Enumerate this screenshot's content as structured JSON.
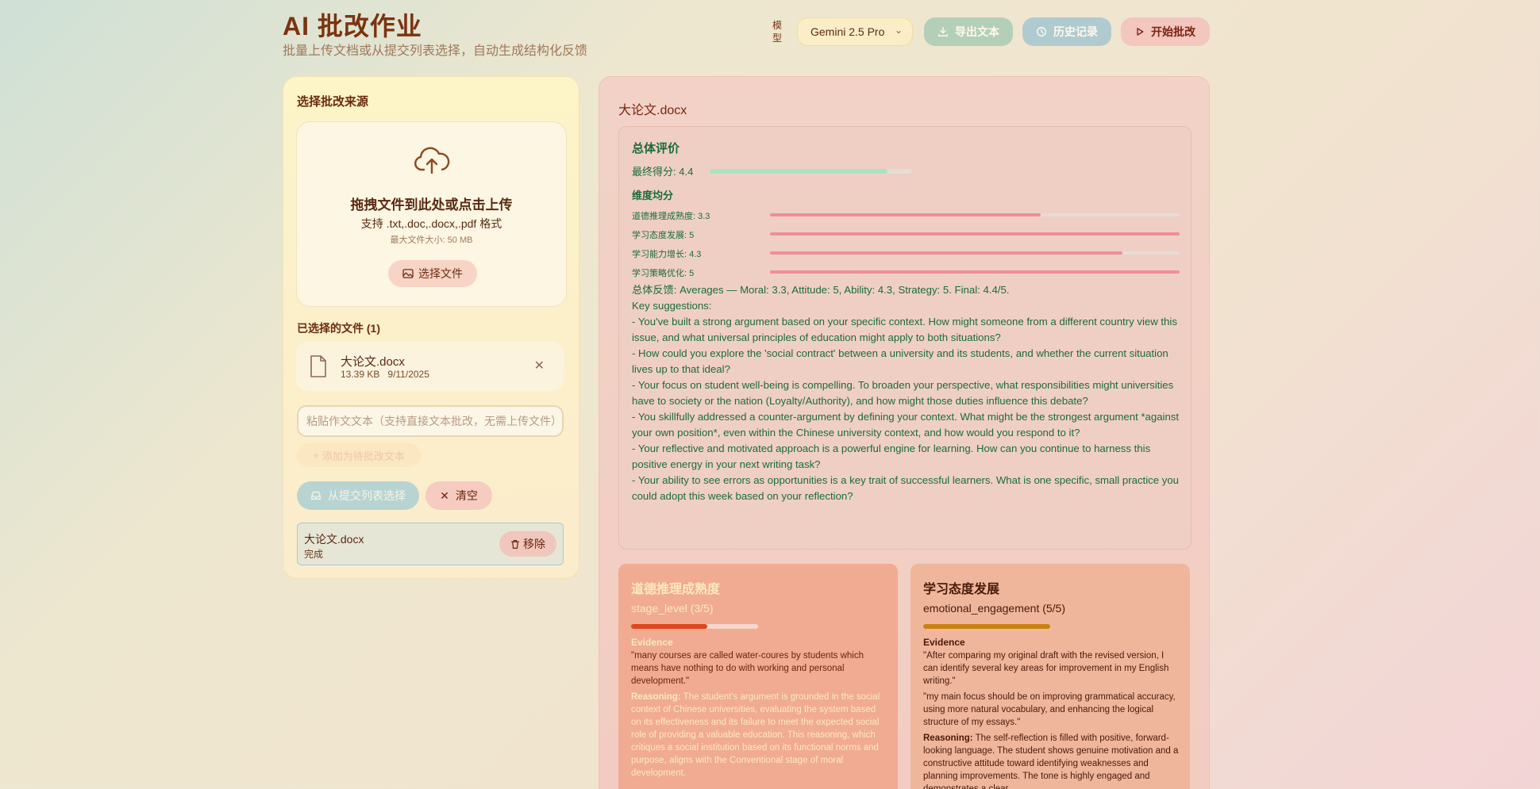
{
  "header": {
    "title": "AI 批改作业",
    "subtitle": "批量上传文档或从提交列表选择，自动生成结构化反馈",
    "model_label": "模型",
    "model_value": "Gemini 2.5 Pro",
    "export_label": "导出文本",
    "history_label": "历史记录",
    "start_label": "开始批改"
  },
  "left": {
    "title": "选择批改来源",
    "dropzone": {
      "title": "拖拽文件到此处或点击上传",
      "formats": "支持 .txt,.doc,.docx,.pdf 格式",
      "max_size": "最大文件大小: 50 MB",
      "choose_label": "选择文件"
    },
    "selected_title": "已选择的文件 (1)",
    "file": {
      "name": "大论文.docx",
      "size": "13.39 KB",
      "date": "9/11/2025"
    },
    "text_placeholder": "粘贴作文文本（支持直接文本批改，无需上传文件）",
    "add_label": "添加为待批改文本",
    "from_list_label": "从提交列表选择",
    "clear_label": "清空",
    "queue": {
      "name": "大论文.docx",
      "status": "完成",
      "remove_label": "移除"
    }
  },
  "right": {
    "title": "大论文.docx",
    "summary": {
      "title": "总体评价",
      "final_score_label": "最终得分: 4.4",
      "final_score": 4.4,
      "final_max": 5,
      "dimensions_title": "维度均分",
      "dimensions": [
        {
          "label": "道德推理成熟度: 3.3",
          "score": 3.3
        },
        {
          "label": "学习态度发展: 5",
          "score": 5
        },
        {
          "label": "学习能力增长: 4.3",
          "score": 4.3
        },
        {
          "label": "学习策略优化: 5",
          "score": 5
        }
      ],
      "feedback": [
        "总体反馈: Averages — Moral: 3.3, Attitude: 5, Ability: 4.3, Strategy: 5. Final: 4.4/5.",
        "Key suggestions:",
        "- You've built a strong argument based on your specific context. How might someone from a different country view this issue, and what universal principles of education might apply to both situations?",
        "- How could you explore the 'social contract' between a university and its students, and whether the current situation lives up to that ideal?",
        "- Your focus on student well-being is compelling. To broaden your perspective, what responsibilities might universities have to society or the nation (Loyalty/Authority), and how might those duties influence this debate?",
        "- You skillfully addressed a counter-argument by defining your context. What might be the strongest argument *against your own position*, even within the Chinese university context, and how would you respond to it?",
        "- Your reflective and motivated approach is a powerful engine for learning. How can you continue to harness this positive energy in your next writing task?",
        "- Your ability to see errors as opportunities is a key trait of successful learners. What is one specific, small practice you could adopt this week based on your reflection?"
      ]
    },
    "cards": [
      {
        "title": "道德推理成熟度",
        "metric": "stage_level (3/5)",
        "score": 3,
        "max": 5,
        "evidence_title": "Evidence",
        "quotes": [
          "\"many courses are called water-coures by students which means have nothing to do with working and personal development.\""
        ],
        "reasoning_label": "Reasoning:",
        "reasoning": "The student's argument is grounded in the social context of Chinese universities, evaluating the system based on its effectiveness and its failure to meet the expected social role of providing a valuable education. This reasoning, which critiques a social institution based on its functional norms and purpose, aligns with the Conventional stage of moral development."
      },
      {
        "title": "学习态度发展",
        "metric": "emotional_engagement (5/5)",
        "score": 5,
        "max": 5,
        "evidence_title": "Evidence",
        "quotes": [
          "\"After comparing my original draft with the revised version, I can identify several key areas for improvement in my English writing.\"",
          "\"my main focus should be on improving grammatical accuracy, using more natural vocabulary, and enhancing the logical structure of my essays.\""
        ],
        "reasoning_label": "Reasoning:",
        "reasoning": "The self-reflection is filled with positive, forward-looking language. The student shows genuine motivation and a constructive attitude toward identifying weaknesses and planning improvements. The tone is highly engaged and demonstrates a clear"
      }
    ]
  },
  "colors": {
    "accent": "#7a3410",
    "green_text": "#1b6b3c",
    "dim_bar": "#f08e98",
    "final_bar": "#a9e3c0"
  }
}
